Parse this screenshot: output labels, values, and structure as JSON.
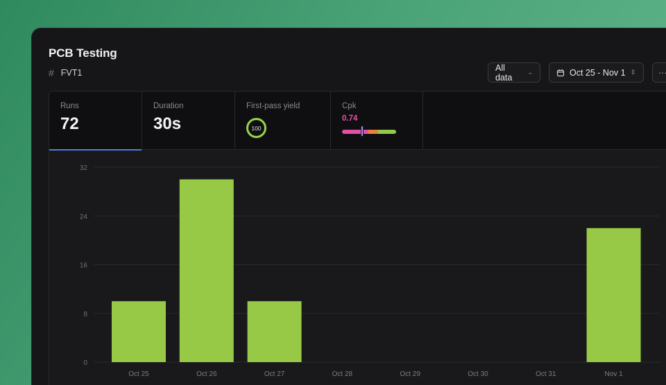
{
  "header": {
    "title": "PCB Testing",
    "subtitle_icon": "#",
    "subtitle": "FVT1"
  },
  "toolbar": {
    "filter_label": "All data",
    "filter_chevron": "⌄",
    "date_range": "Oct 25 - Nov 1",
    "date_chevron": "⇕",
    "more_label": "···"
  },
  "stats": {
    "runs": {
      "label": "Runs",
      "value": "72"
    },
    "duration": {
      "label": "Duration",
      "value": "30s"
    },
    "yield": {
      "label": "First-pass yield",
      "value": "100"
    },
    "cpk": {
      "label": "Cpk",
      "value": "0.74"
    }
  },
  "colors": {
    "accent": "#4d7fe6",
    "bar": "#98c946",
    "cpk_value": "#ea4fa5"
  },
  "chart_data": {
    "type": "bar",
    "categories": [
      "Oct 25",
      "Oct 26",
      "Oct 27",
      "Oct 28",
      "Oct 29",
      "Oct 30",
      "Oct 31",
      "Nov 1"
    ],
    "values": [
      10,
      30,
      10,
      0,
      0,
      0,
      0,
      22
    ],
    "yticks": [
      0,
      8,
      16,
      24,
      32
    ],
    "ylim": [
      0,
      32
    ],
    "grid": true
  }
}
